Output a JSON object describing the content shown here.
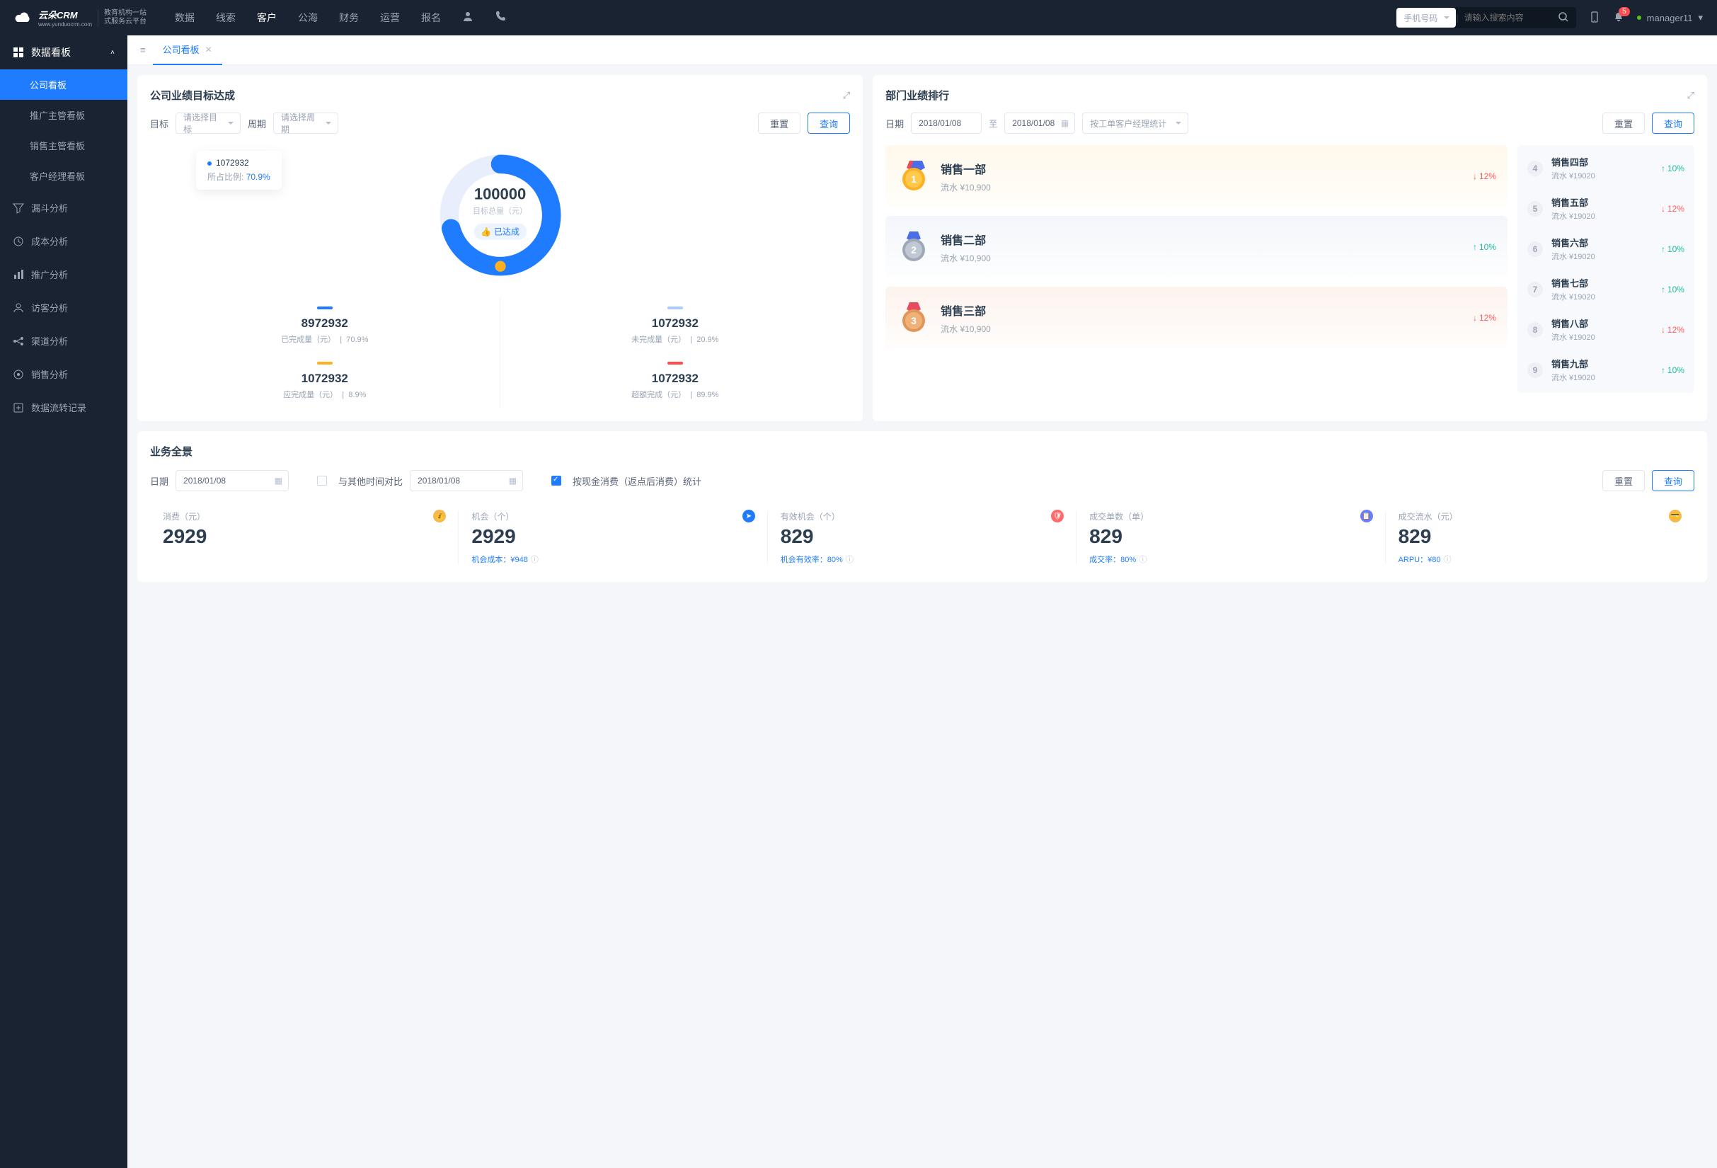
{
  "brand": {
    "name": "云朵CRM",
    "tagline1": "教育机构一站",
    "tagline2": "式服务云平台",
    "url": "www.yunduocrm.com"
  },
  "topnav": [
    "数据",
    "线索",
    "客户",
    "公海",
    "财务",
    "运营",
    "报名"
  ],
  "topnav_active": 2,
  "search": {
    "type": "手机号码",
    "placeholder": "请输入搜索内容"
  },
  "notif_count": "5",
  "user": "manager11",
  "sidebar": {
    "group": "数据看板",
    "items": [
      "公司看板",
      "推广主管看板",
      "销售主管看板",
      "客户经理看板"
    ],
    "active": 0,
    "sections": [
      "漏斗分析",
      "成本分析",
      "推广分析",
      "访客分析",
      "渠道分析",
      "销售分析",
      "数据流转记录"
    ]
  },
  "tab": {
    "label": "公司看板"
  },
  "card1": {
    "title": "公司业绩目标达成",
    "target_label": "目标",
    "target_ph": "请选择目标",
    "period_label": "周期",
    "period_ph": "请选择周期",
    "reset": "重置",
    "query": "查询",
    "center_val": "100000",
    "center_sub": "目标总量（元）",
    "achieve": "已达成",
    "tooltip": {
      "v": "1072932",
      "ratio_label": "所占比例:",
      "ratio": "70.9%"
    },
    "stats": [
      {
        "num": "8972932",
        "label": "已完成量（元）",
        "pct": "70.9%"
      },
      {
        "num": "1072932",
        "label": "未完成量（元）",
        "pct": "20.9%"
      },
      {
        "num": "1072932",
        "label": "应完成量（元）",
        "pct": "8.9%"
      },
      {
        "num": "1072932",
        "label": "超额完成（元）",
        "pct": "89.9%"
      }
    ]
  },
  "card2": {
    "title": "部门业绩排行",
    "date_label": "日期",
    "date_from": "2018/01/08",
    "date_to": "2018/01/08",
    "to": "至",
    "stat_by": "按工单客户经理统计",
    "reset": "重置",
    "query": "查询",
    "top3": [
      {
        "rank": "1",
        "name": "销售一部",
        "flow": "流水 ¥10,900",
        "pct": "12%",
        "dir": "down"
      },
      {
        "rank": "2",
        "name": "销售二部",
        "flow": "流水 ¥10,900",
        "pct": "10%",
        "dir": "up"
      },
      {
        "rank": "3",
        "name": "销售三部",
        "flow": "流水 ¥10,900",
        "pct": "12%",
        "dir": "down"
      }
    ],
    "rest": [
      {
        "rank": "4",
        "name": "销售四部",
        "flow": "流水 ¥19020",
        "pct": "10%",
        "dir": "up"
      },
      {
        "rank": "5",
        "name": "销售五部",
        "flow": "流水 ¥19020",
        "pct": "12%",
        "dir": "down"
      },
      {
        "rank": "6",
        "name": "销售六部",
        "flow": "流水 ¥19020",
        "pct": "10%",
        "dir": "up"
      },
      {
        "rank": "7",
        "name": "销售七部",
        "flow": "流水 ¥19020",
        "pct": "10%",
        "dir": "up"
      },
      {
        "rank": "8",
        "name": "销售八部",
        "flow": "流水 ¥19020",
        "pct": "12%",
        "dir": "down"
      },
      {
        "rank": "9",
        "name": "销售九部",
        "flow": "流水 ¥19020",
        "pct": "10%",
        "dir": "up"
      }
    ]
  },
  "card3": {
    "title": "业务全景",
    "date_label": "日期",
    "date1": "2018/01/08",
    "compare_label": "与其他时间对比",
    "date2": "2018/01/08",
    "cb_label": "按现金消费（返点后消费）统计",
    "reset": "重置",
    "query": "查询",
    "kpis": [
      {
        "label": "消费（元）",
        "val": "2929",
        "sub": "",
        "icon": "#f7b84b"
      },
      {
        "label": "机会（个）",
        "val": "2929",
        "sub": "机会成本：¥948",
        "icon": "#1f7cff"
      },
      {
        "label": "有效机会（个）",
        "val": "829",
        "sub": "机会有效率：80%",
        "icon": "#ff6b6b"
      },
      {
        "label": "成交单数（单）",
        "val": "829",
        "sub": "成交率：80%",
        "icon": "#6a7dff"
      },
      {
        "label": "成交流水（元）",
        "val": "829",
        "sub": "ARPU：¥80",
        "icon": "#f7b84b"
      }
    ]
  },
  "chart_data": {
    "type": "pie",
    "title": "目标总量（元）",
    "total": 100000,
    "series": [
      {
        "name": "已完成",
        "value": 70.9,
        "color": "#1f7cff"
      },
      {
        "name": "未完成",
        "value": 29.1,
        "color": "#e8eefb"
      }
    ],
    "tooltip": {
      "value": 1072932,
      "ratio": 70.9
    }
  }
}
